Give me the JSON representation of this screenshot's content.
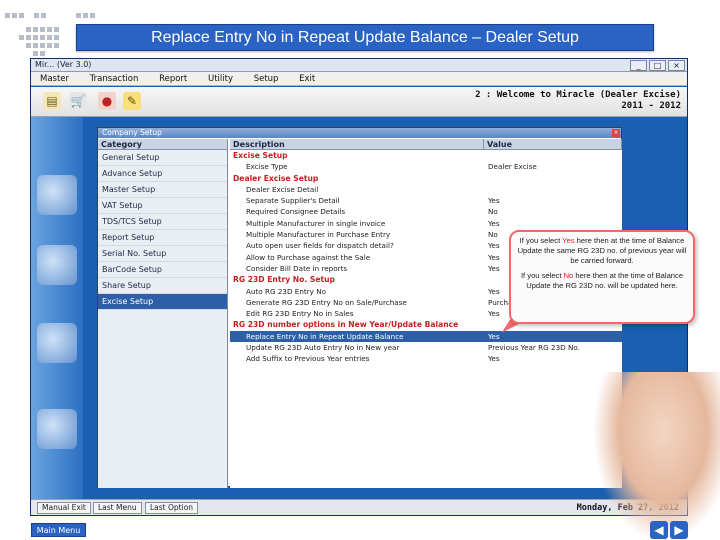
{
  "slide": {
    "title": "Replace Entry No in Repeat Update Balance – Dealer Setup",
    "main_menu_label": "Main Menu"
  },
  "window": {
    "title": "Mir... (Ver 3.0)",
    "controls": [
      "_",
      "□",
      "×"
    ]
  },
  "menubar": [
    "Master",
    "Transaction",
    "Report",
    "Utility",
    "Setup",
    "Exit"
  ],
  "toolbar": {
    "icons": [
      "document-icon",
      "cart-icon",
      "money-bag-icon",
      "edit-icon"
    ],
    "welcome_line1": "2 : Welcome to Miracle (Dealer Excise)",
    "welcome_line2": "2011 - 2012"
  },
  "dialog": {
    "title": "Company Setup",
    "category_header": "Category",
    "categories": [
      {
        "label": "General Setup",
        "selected": false
      },
      {
        "label": "Advance Setup",
        "selected": false
      },
      {
        "label": "Master Setup",
        "selected": false
      },
      {
        "label": "VAT Setup",
        "selected": false
      },
      {
        "label": "TDS/TCS Setup",
        "selected": false
      },
      {
        "label": "Report Setup",
        "selected": false
      },
      {
        "label": "Serial No. Setup",
        "selected": false
      },
      {
        "label": "BarCode Setup",
        "selected": false
      },
      {
        "label": "Share Setup",
        "selected": false
      },
      {
        "label": "Excise Setup",
        "selected": true
      }
    ],
    "desc_header": "Description",
    "value_header": "Value",
    "rows": [
      {
        "desc": "Excise Setup",
        "value": "",
        "type": "section"
      },
      {
        "desc": "Excise Type",
        "value": "Dealer Excise",
        "type": "row"
      },
      {
        "desc": "Dealer Excise Setup",
        "value": "",
        "type": "section"
      },
      {
        "desc": "Dealer Excise Detail",
        "value": "",
        "type": "row"
      },
      {
        "desc": "Separate Supplier's Detail",
        "value": "Yes",
        "type": "row"
      },
      {
        "desc": "Required Consignee Details",
        "value": "No",
        "type": "row"
      },
      {
        "desc": "Multiple Manufacturer in single invoice",
        "value": "Yes",
        "type": "row"
      },
      {
        "desc": "Multiple Manufacturer in Purchase Entry",
        "value": "No",
        "type": "row"
      },
      {
        "desc": "Auto open user fields for dispatch detail?",
        "value": "Yes",
        "type": "row"
      },
      {
        "desc": "Allow to Purchase against the Sale",
        "value": "Yes",
        "type": "row"
      },
      {
        "desc": "Consider Bill Date in reports",
        "value": "Yes",
        "type": "row"
      },
      {
        "desc": "RG 23D Entry No. Setup",
        "value": "",
        "type": "section"
      },
      {
        "desc": "Auto RG 23D Entry No",
        "value": "Yes",
        "type": "row"
      },
      {
        "desc": "Generate RG 23D Entry No on Sale/Purchase",
        "value": "Purchase",
        "type": "row"
      },
      {
        "desc": "Edit RG 23D Entry No in Sales",
        "value": "Yes",
        "type": "row"
      },
      {
        "desc": "RG 23D number options in New Year/Update Balance",
        "value": "",
        "type": "section"
      },
      {
        "desc": "Replace Entry No in Repeat Update Balance",
        "value": "Yes",
        "type": "highlight"
      },
      {
        "desc": "Update RG 23D Auto Entry No in New year",
        "value": "Previous Year RG 23D No.",
        "type": "row"
      },
      {
        "desc": "Add Suffix to Previous Year entries",
        "value": "Yes",
        "type": "row"
      }
    ]
  },
  "callout": {
    "p1_before": "If you select ",
    "p1_keyword": "Yes",
    "p1_after": " here then at the time of Balance Update the same RG 23D no. of previous year will be carried forward.",
    "p2_before": "If you select ",
    "p2_keyword": "No",
    "p2_after": " here then at the time of Balance Update the RG 23D no. will be updated here."
  },
  "statusbar": {
    "buttons": [
      "Manual Exit",
      "Last Menu",
      "Last Option"
    ],
    "date": "Monday, Feb 27, 2012"
  },
  "nav": {
    "prev": "◀",
    "next": "▶"
  }
}
